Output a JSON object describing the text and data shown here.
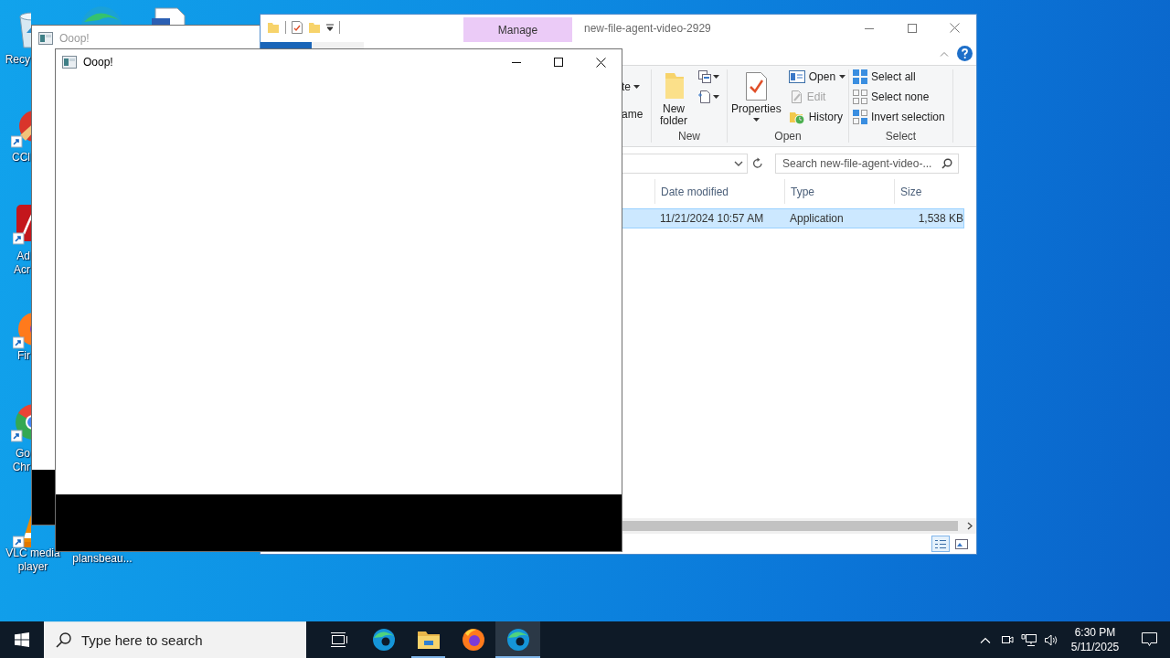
{
  "desktop": {
    "icons": [
      {
        "kind": "recycle-bin",
        "label": "Recy",
        "shortcut": false
      },
      {
        "kind": "edge"
      },
      {
        "kind": "document"
      },
      {
        "kind": "ccleaner",
        "label": "CCl",
        "shortcut": true
      },
      {
        "kind": "acrobat",
        "label": "Ad\nAcr",
        "shortcut": true
      },
      {
        "kind": "firefox",
        "label": "Fir",
        "shortcut": true
      },
      {
        "kind": "chrome",
        "label": "Go\nChr",
        "shortcut": true
      },
      {
        "kind": "vlc",
        "label": "VLC media player",
        "shortcut": true
      },
      {
        "kind": "file",
        "label": "plansbeau..."
      }
    ]
  },
  "windows": [
    {
      "kind": "dialog",
      "title": "Ooop!",
      "active": false
    },
    {
      "kind": "explorer",
      "context_tab": "Manage",
      "title": "new-file-agent-video-2929",
      "ribbon": [
        {
          "items": [
            {
              "label": "te",
              "dropdown": true
            },
            {
              "label": "ame",
              "dropdown": false
            }
          ]
        },
        {
          "name": "New",
          "items": [
            {
              "label": "New\nfolder",
              "dropdown": false
            },
            {
              "dropdown": true
            },
            {
              "dropdown": true
            }
          ]
        },
        {
          "name": "Open",
          "items": [
            {
              "label": "Properties",
              "dropdown": true,
              "disabled": false
            },
            {
              "label": "Open",
              "dropdown": true,
              "disabled": false
            },
            {
              "label": "Edit",
              "dropdown": false,
              "disabled": true
            },
            {
              "label": "History",
              "dropdown": false,
              "disabled": false
            }
          ]
        },
        {
          "name": "Select",
          "items": [
            {
              "label": "Select all"
            },
            {
              "label": "Select none"
            },
            {
              "label": "Invert selection"
            }
          ]
        }
      ],
      "search": {
        "placeholder": "Search new-file-agent-video-..."
      },
      "columns": [
        "Date modified",
        "Type",
        "Size"
      ],
      "rows": [
        {
          "cells": [
            "11/21/2024 10:57 AM",
            "Application",
            "1,538 KB"
          ],
          "selected": true
        }
      ]
    },
    {
      "kind": "dialog",
      "title": "Ooop!",
      "active": true
    }
  ],
  "taskbar": {
    "search": {
      "placeholder": "Type here to search"
    },
    "apps": [
      {
        "kind": "task-view",
        "open": false,
        "selected": false
      },
      {
        "kind": "edge",
        "open": false,
        "selected": false
      },
      {
        "kind": "explorer",
        "open": true,
        "selected": false
      },
      {
        "kind": "firefox",
        "open": false,
        "selected": false
      },
      {
        "kind": "edge",
        "open": true,
        "selected": true
      }
    ],
    "clock": {
      "time": "6:30 PM",
      "date": "5/11/2025"
    }
  }
}
